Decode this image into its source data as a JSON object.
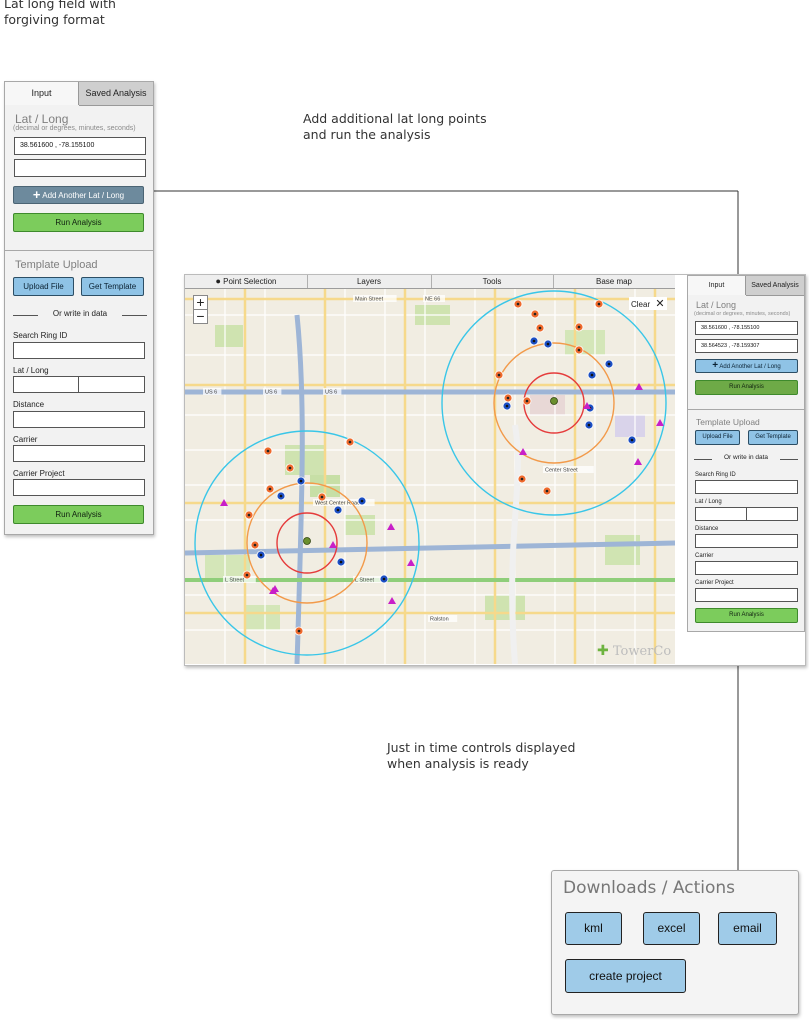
{
  "notes": {
    "top_left": "Lat long field with\nforgiving format",
    "middle": "Add additional lat long points\nand run the analysis",
    "bottom": "Just in time controls displayed\nwhen analysis is ready"
  },
  "left_panel": {
    "tabs": [
      "Input",
      "Saved Analysis"
    ],
    "latlong_title": "Lat / Long",
    "latlong_hint": "(decimal or degrees, minutes, seconds)",
    "latlong_value_1": "38.561600 ,  -78.155100",
    "latlong_value_2": "",
    "add_latlong_button": "Add Another Lat / Long",
    "run_analysis_button": "Run Analysis",
    "template_title": "Template Upload",
    "upload_file_button": "Upload File",
    "get_template_button": "Get Template",
    "or_write": "Or write in data",
    "search_ring_label": "Search Ring ID",
    "latlong_label": "Lat / Long",
    "distance_label": "Distance",
    "carrier_label": "Carrier",
    "carrier_project_label": "Carrier Project",
    "run_analysis_button_2": "Run Analysis"
  },
  "map": {
    "tabs": [
      "Point Selection",
      "Layers",
      "Tools",
      "Base map"
    ],
    "zoom_in": "+",
    "zoom_out": "−",
    "clear_label": "Clear",
    "brand": "TowerCo",
    "street_labels": [
      "US 6",
      "US 6",
      "US 6",
      "Main Street",
      "Center Street",
      "L Street",
      "L Street",
      "NE 66",
      "West Center Road",
      "Ralston"
    ]
  },
  "right_panel": {
    "tabs": [
      "Input",
      "Saved Analysis"
    ],
    "latlong_title": "Lat / Long",
    "latlong_hint": "(decimal or degrees, minutes, seconds)",
    "latlong_value_1": "38.561600 ,  -78.155100",
    "latlong_value_2": "38.564523 ,  -78.159307",
    "add_latlong_button": "Add Another Lat / Long",
    "run_analysis_button": "Run Analysis",
    "template_title": "Template Upload",
    "upload_file_button": "Upload File",
    "get_template_button": "Get Template",
    "or_write": "Or write in data",
    "search_ring_label": "Search Ring ID",
    "latlong_label": "Lat / Long",
    "distance_label": "Distance",
    "carrier_label": "Carrier",
    "carrier_project_label": "Carrier Project",
    "run_analysis_button_2": "Run Analysis"
  },
  "downloads": {
    "title": "Downloads / Actions",
    "kml": "kml",
    "excel": "excel",
    "email": "email",
    "create_project": "create project"
  },
  "colors": {
    "connector": "#333333",
    "ring_outer": "#39c6e8",
    "ring_mid": "#f29a4a",
    "ring_inner": "#e53b3b",
    "marker_orange": "#ef6a2c",
    "marker_blue": "#1c4fc4",
    "marker_magenta": "#c81fc8"
  }
}
